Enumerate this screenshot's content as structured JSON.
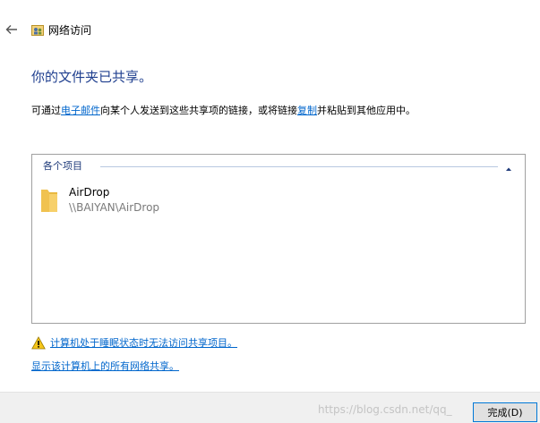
{
  "window": {
    "title": "网络访问"
  },
  "heading": "你的文件夹已共享。",
  "description": {
    "part1": "可通过",
    "email_link": "电子邮件",
    "part2": "向某个人发送到这些共享项的链接，或将链接",
    "copy_link": "复制",
    "part3": "并粘贴到其他应用中。"
  },
  "panel": {
    "group_label": "各个项目",
    "items": [
      {
        "name": "AirDrop",
        "path": "\\\\BAIYAN\\AirDrop"
      }
    ]
  },
  "links": {
    "sleep_warning": "计算机处于睡眠状态时无法访问共享项目。",
    "show_all_shares": "显示该计算机上的所有网络共享。"
  },
  "footer": {
    "finish_button": "完成(D)",
    "watermark": "https://blog.csdn.net/qq_"
  },
  "icons": {
    "back": "back-arrow-icon",
    "network": "network-access-icon",
    "folder": "folder-icon",
    "warning": "warning-icon",
    "collapse": "chevron-up-icon"
  },
  "colors": {
    "heading": "#1f3f8f",
    "link": "#0066cc",
    "accent": "#0078d7",
    "folder": "#f3c64f"
  }
}
